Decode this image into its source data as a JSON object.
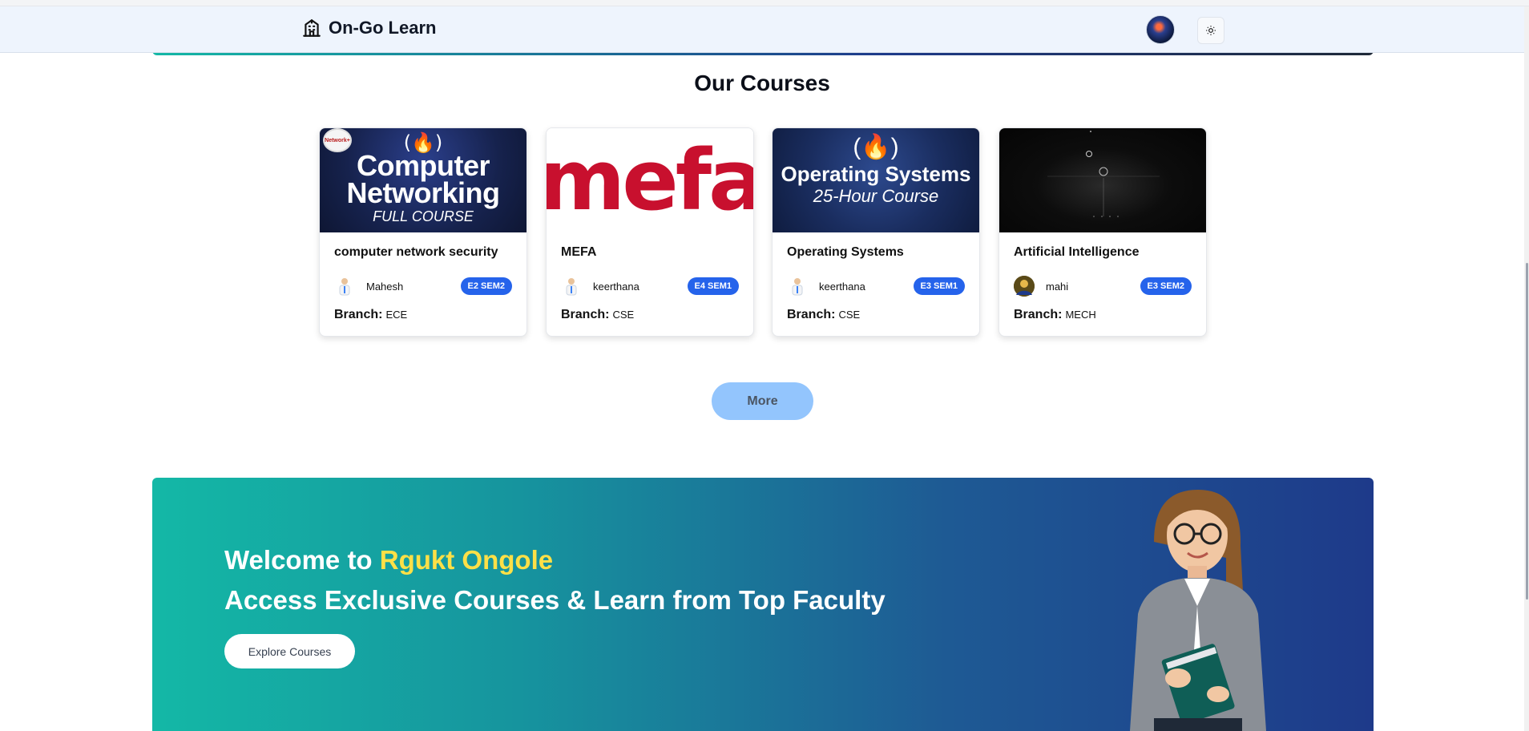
{
  "header": {
    "brand": "On-Go Learn",
    "brand_icon": "school-building-icon",
    "avatar_icon": "user-avatar",
    "theme_icon": "sun-icon"
  },
  "courses_section": {
    "title": "Our Courses",
    "cards": [
      {
        "thumb": {
          "logo": "(🔥)",
          "line1": "Computer",
          "line1b": "Networking",
          "line2": "FULL COURSE",
          "seal": "Network+"
        },
        "title": "computer network security",
        "author": "Mahesh",
        "badge": "E2 SEM2",
        "branch_label": "Branch:",
        "branch": "ECE"
      },
      {
        "thumb": {
          "text": "mefa"
        },
        "title": "MEFA",
        "author": "keerthana",
        "badge": "E4 SEM1",
        "branch_label": "Branch:",
        "branch": "CSE"
      },
      {
        "thumb": {
          "logo": "(🔥)",
          "line1": "Operating Systems",
          "line2": "25-Hour Course"
        },
        "title": "Operating Systems",
        "author": "keerthana",
        "badge": "E3 SEM1",
        "branch_label": "Branch:",
        "branch": "CSE"
      },
      {
        "thumb": {},
        "title": "Artificial Intelligence",
        "author": "mahi",
        "badge": "E3 SEM2",
        "branch_label": "Branch:",
        "branch": "MECH"
      }
    ],
    "more_label": "More"
  },
  "banner": {
    "welcome": "Welcome to ",
    "highlight": "Rgukt Ongole",
    "tagline": "Access Exclusive Courses & Learn from Top Faculty",
    "cta": "Explore Courses",
    "colors": {
      "start": "#14b8a6",
      "end": "#1e3a8a",
      "highlight": "#fde047"
    }
  },
  "colors": {
    "badge": "#2563eb",
    "more_button": "#93c5fd",
    "header_bg": "#eef4fd"
  }
}
